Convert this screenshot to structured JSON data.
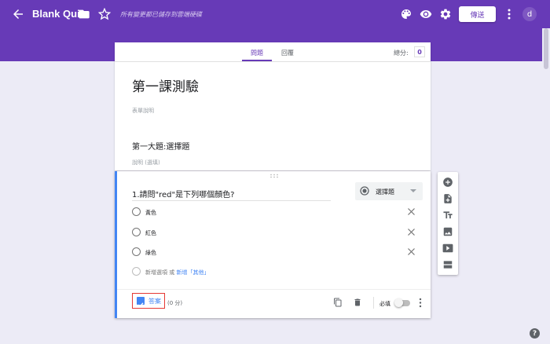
{
  "header": {
    "title": "Blank Quiz",
    "save_status": "所有變更都已儲存到雲端硬碟",
    "send_label": "傳送",
    "avatar_letter": "d"
  },
  "tabs": {
    "questions": "問題",
    "responses": "回覆",
    "total_points_label": "總分:",
    "total_points_value": "0"
  },
  "form": {
    "title": "第一課測驗",
    "description_placeholder": "表單說明"
  },
  "section": {
    "title": "第一大題:選擇題",
    "description_placeholder": "說明 (選填)"
  },
  "question": {
    "title": "1.請問\"red\"是下列哪個顏色?",
    "type": "選擇題",
    "options": [
      {
        "label": "黃色"
      },
      {
        "label": "紅色"
      },
      {
        "label": "綠色"
      }
    ],
    "add_option": "新增選項",
    "or": "或",
    "add_other": "新增「其他」",
    "answer_key_label": "答案",
    "points": "(0 分)",
    "required_label": "必填",
    "required_on": false
  },
  "colors": {
    "brand": "#673ab7",
    "accent": "#4285f4",
    "highlight_border": "#e53935"
  },
  "side_toolbar": {
    "tools": [
      "add-question-icon",
      "import-questions-icon",
      "add-title-icon",
      "add-image-icon",
      "add-video-icon",
      "add-section-icon"
    ]
  }
}
